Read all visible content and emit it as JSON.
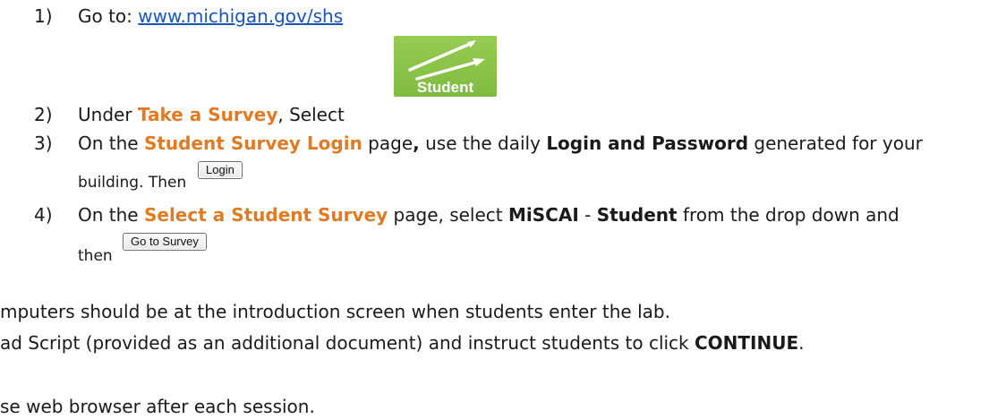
{
  "steps": [
    {
      "number": "1)",
      "prefix": "Go to: ",
      "link": "www.michigan.gov/shs"
    },
    {
      "number": "2)",
      "prefix": "Under ",
      "highlight": "Take a Survey",
      "suffix": ", Select"
    },
    {
      "number": "3)",
      "prefix": "On the ",
      "highlight": "Student Survey Login",
      "middle": " page",
      "comma": ",",
      "middle2": " use the daily ",
      "bold": "Login and Password",
      "suffix": " generated for your",
      "line2": "building.  Then"
    },
    {
      "number": "4)",
      "prefix": "On the ",
      "highlight": "Select a Student Survey",
      "middle": " page, select ",
      "bold1": "MiSCAI",
      "dash": " - ",
      "bold2": "Student",
      "suffix": " from the drop down and",
      "line2": "then"
    }
  ],
  "student_icon": {
    "label": "Student",
    "icon": "pencils-icon",
    "color": "#8bc34a"
  },
  "login_button": {
    "label": "Login"
  },
  "survey_button": {
    "label": "Go to Survey"
  },
  "notes": [
    {
      "text": "mputers should be at the introduction screen when students enter the lab."
    },
    {
      "prefix": "ad Script (provided as an additional document) and instruct students to click ",
      "bold": "CONTINUE",
      "suffix": "."
    },
    {
      "text": "se web browser after each session."
    }
  ],
  "colors": {
    "highlight": "#e07b25",
    "link": "#1a55b8",
    "text": "#1a1a1a"
  }
}
